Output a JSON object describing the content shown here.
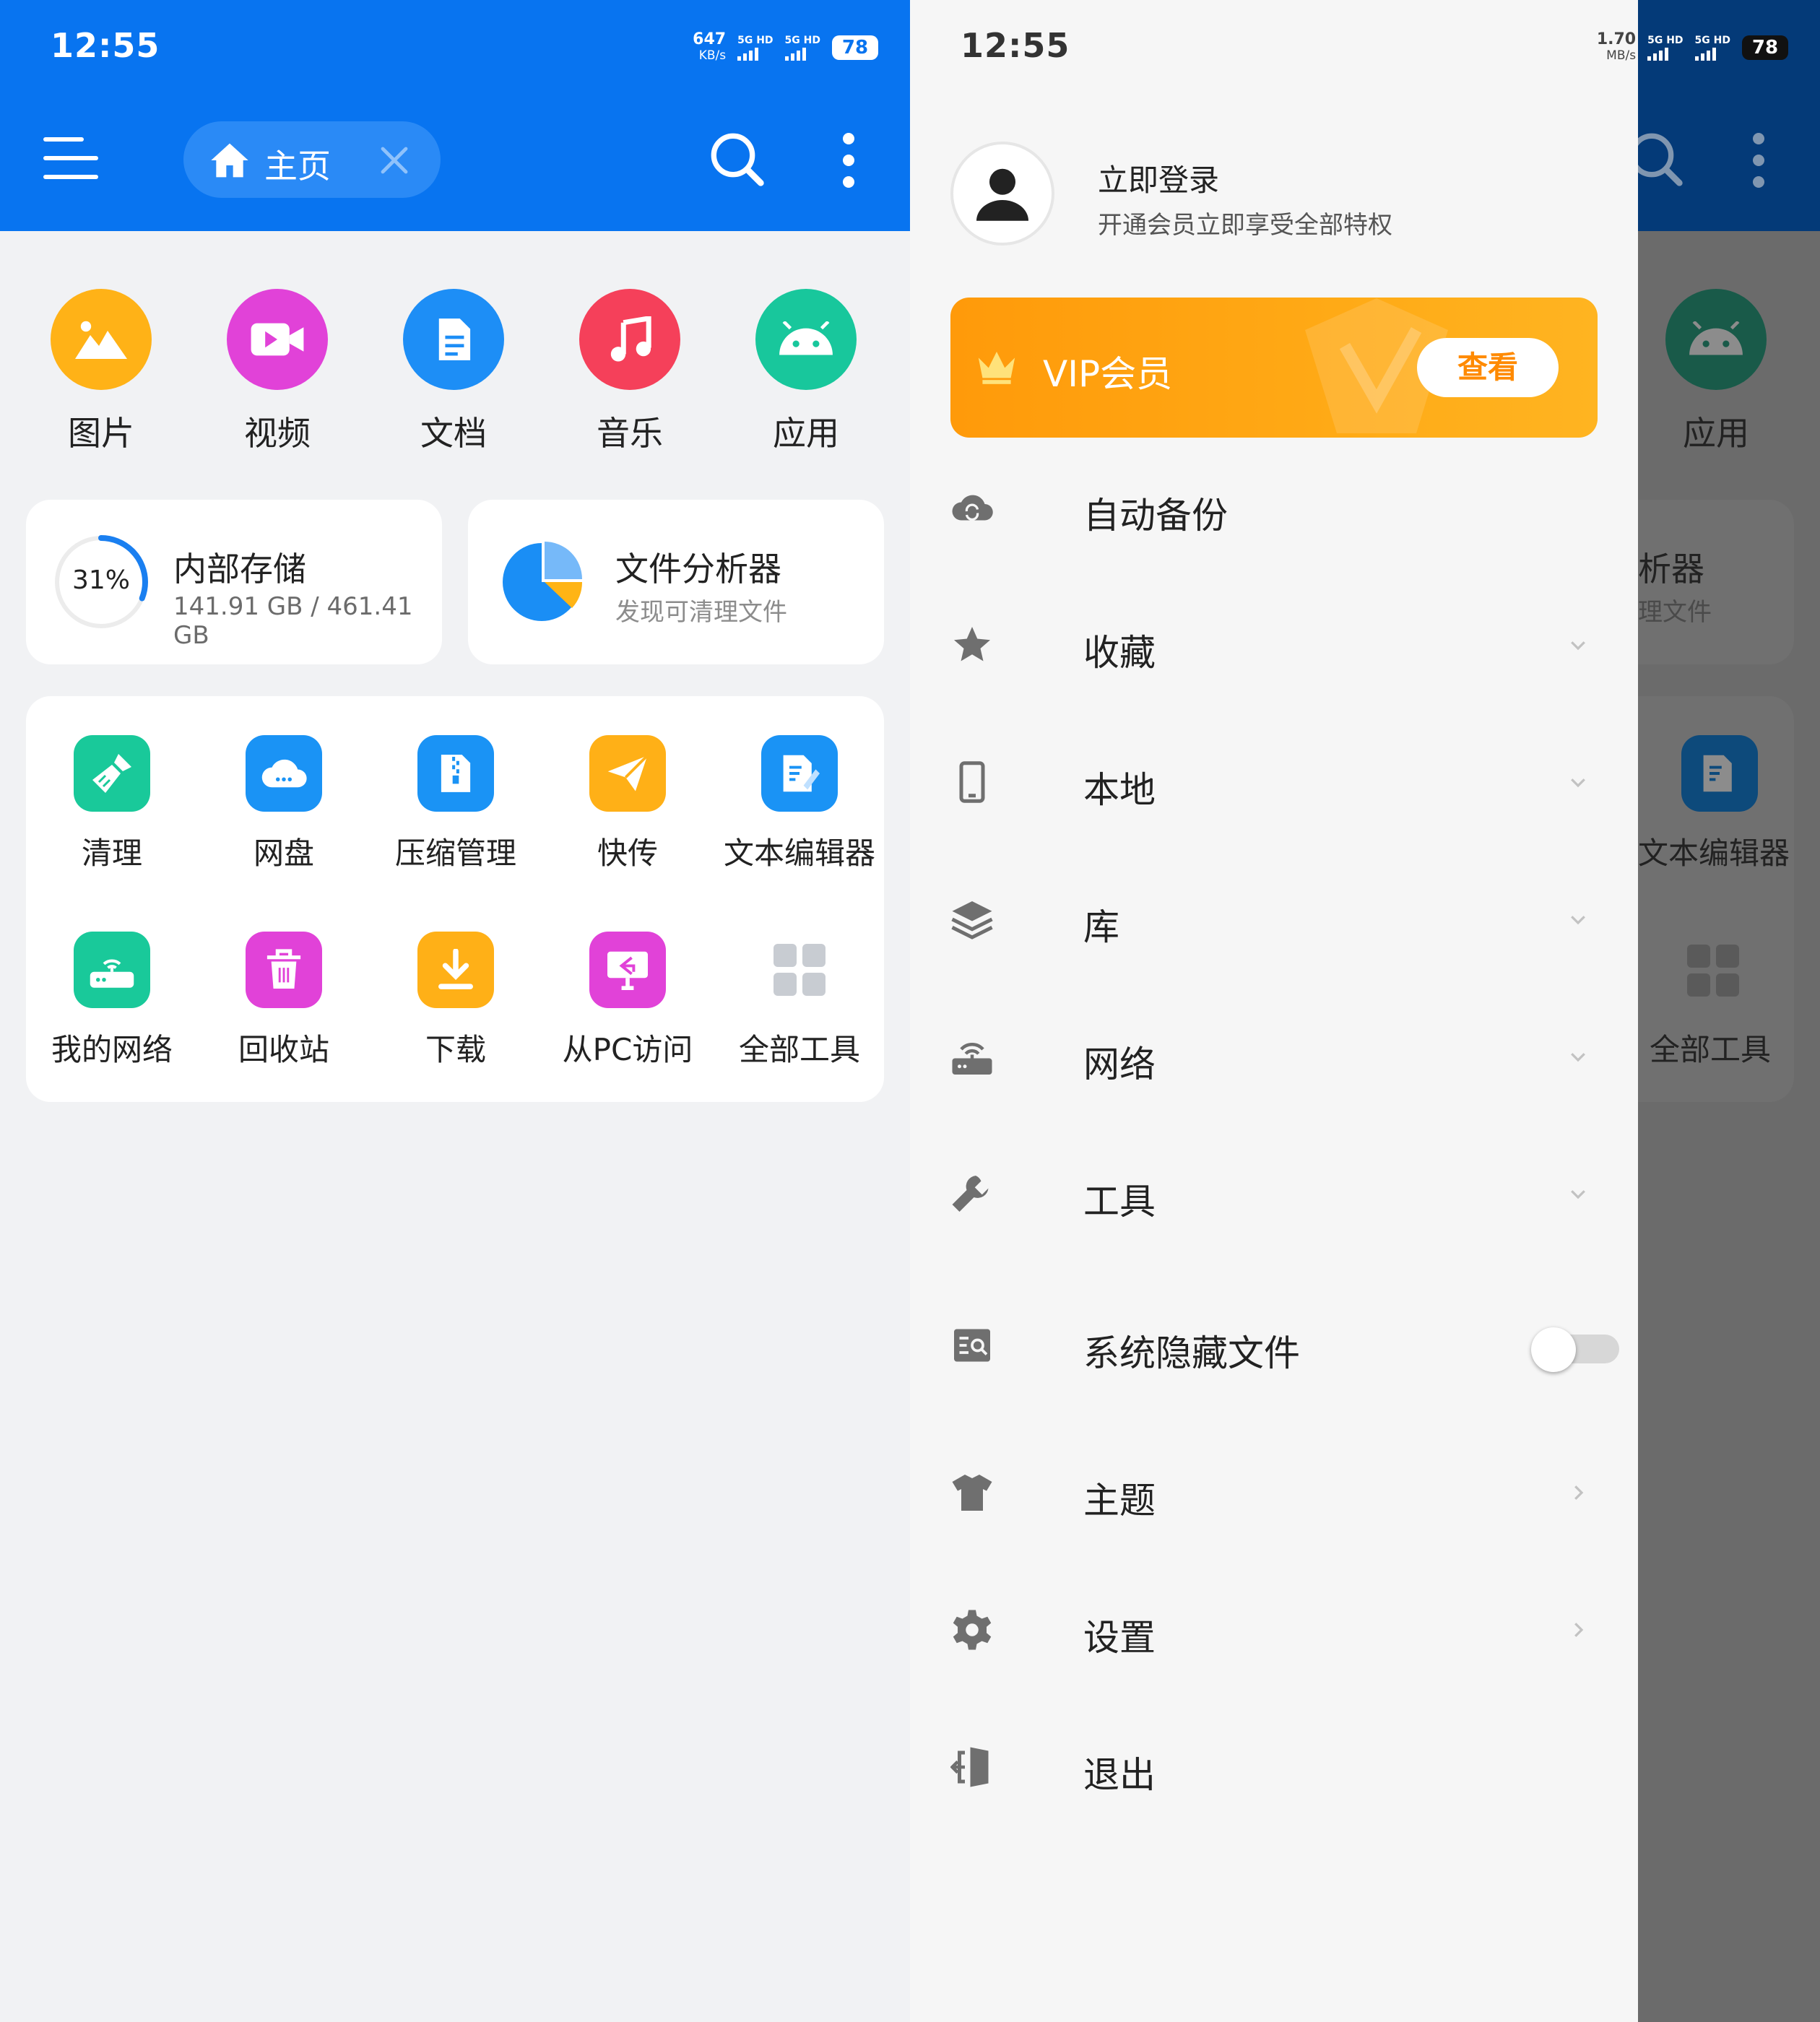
{
  "left": {
    "status": {
      "time": "12:55",
      "speed_value": "647",
      "speed_unit": "KB/s",
      "sim1": "5G HD",
      "sim2": "5G HD",
      "battery": "78"
    },
    "toolbar": {
      "home_label": "主页"
    },
    "categories": [
      {
        "label": "图片",
        "color": "#ffb217",
        "icon": "image-icon"
      },
      {
        "label": "视频",
        "color": "#e142d8",
        "icon": "video-icon"
      },
      {
        "label": "文档",
        "color": "#1d8ef6",
        "icon": "document-icon"
      },
      {
        "label": "音乐",
        "color": "#f5405a",
        "icon": "music-icon"
      },
      {
        "label": "应用",
        "color": "#18c79c",
        "icon": "android-icon"
      }
    ],
    "storage": {
      "percent_label": "31%",
      "percent": 31,
      "title": "内部存储",
      "detail": "141.91 GB / 461.41 GB"
    },
    "analyzer": {
      "title": "文件分析器",
      "subtitle": "发现可清理文件"
    },
    "tools": [
      {
        "label": "清理",
        "color": "#19c99a",
        "icon": "broom-icon"
      },
      {
        "label": "网盘",
        "color": "#1a93f5",
        "icon": "cloud-icon"
      },
      {
        "label": "压缩管理",
        "color": "#1a93f5",
        "icon": "zip-icon"
      },
      {
        "label": "快传",
        "color": "#ffb017",
        "icon": "send-icon"
      },
      {
        "label": "文本编辑器",
        "color": "#1a93f5",
        "icon": "text-edit-icon"
      },
      {
        "label": "我的网络",
        "color": "#19c99a",
        "icon": "router-icon"
      },
      {
        "label": "回收站",
        "color": "#e142d8",
        "icon": "trash-icon"
      },
      {
        "label": "下载",
        "color": "#ffb017",
        "icon": "download-icon"
      },
      {
        "label": "从PC访问",
        "color": "#e142d8",
        "icon": "pc-access-icon"
      },
      {
        "label": "全部工具",
        "color": "#c8ccd2",
        "icon": "grid-icon"
      }
    ]
  },
  "right": {
    "status": {
      "time": "12:55",
      "speed_value": "1.70",
      "speed_unit": "MB/s",
      "sim1": "5G HD",
      "sim2": "5G HD",
      "battery": "78"
    },
    "background": {
      "app_label": "应用",
      "analyzer_fragment": "析器",
      "analyzer_sub_fragment": "理文件",
      "text_editor": "文本编辑器",
      "all_tools": "全部工具"
    },
    "drawer": {
      "login_title": "立即登录",
      "login_subtitle": "开通会员立即享受全部特权",
      "vip_label": "VIP会员",
      "vip_button": "查看",
      "items": [
        {
          "label": "自动备份",
          "icon": "cloud-sync-icon",
          "trailing": "none"
        },
        {
          "label": "收藏",
          "icon": "star-icon",
          "trailing": "expand"
        },
        {
          "label": "本地",
          "icon": "phone-icon",
          "trailing": "expand"
        },
        {
          "label": "库",
          "icon": "layers-icon",
          "trailing": "expand"
        },
        {
          "label": "网络",
          "icon": "router-icon",
          "trailing": "expand"
        },
        {
          "label": "工具",
          "icon": "wrench-icon",
          "trailing": "expand"
        },
        {
          "label": "系统隐藏文件",
          "icon": "hidden-file-icon",
          "trailing": "toggle",
          "toggle_on": false
        },
        {
          "label": "主题",
          "icon": "shirt-icon",
          "trailing": "arrow"
        },
        {
          "label": "设置",
          "icon": "gear-icon",
          "trailing": "arrow"
        },
        {
          "label": "退出",
          "icon": "exit-icon",
          "trailing": "none"
        }
      ]
    }
  }
}
